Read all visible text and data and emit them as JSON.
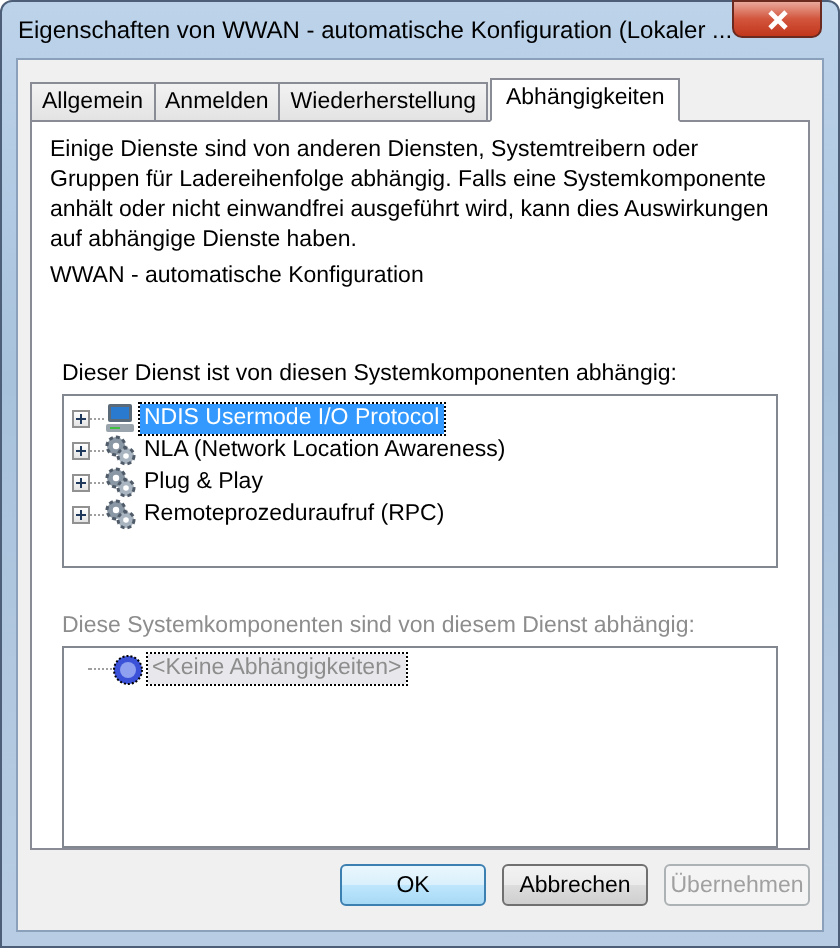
{
  "window": {
    "title": "Eigenschaften von WWAN - automatische Konfiguration (Lokaler ..."
  },
  "tabs": [
    {
      "label": "Allgemein",
      "selected": false
    },
    {
      "label": "Anmelden",
      "selected": false
    },
    {
      "label": "Wiederherstellung",
      "selected": false
    },
    {
      "label": "Abhängigkeiten",
      "selected": true
    }
  ],
  "description": "Einige Dienste sind von anderen Diensten, Systemtreibern oder Gruppen für Ladereihenfolge abhängig. Falls eine Systemkomponente anhält oder nicht einwandfrei ausgeführt wird, kann dies Auswirkungen auf abhängige Dienste haben.",
  "service_name": "WWAN - automatische Konfiguration",
  "depends_on": {
    "label": "Dieser Dienst ist von diesen Systemkomponenten abhängig:",
    "disabled": false,
    "items": [
      {
        "label": "NDIS Usermode I/O Protocol",
        "kind": "computer",
        "selected": true,
        "expanded": false
      },
      {
        "label": "NLA (Network Location Awareness)",
        "kind": "gear",
        "selected": false,
        "expanded": false
      },
      {
        "label": "Plug & Play",
        "kind": "gear",
        "selected": false,
        "expanded": false
      },
      {
        "label": "Remoteprozeduraufruf (RPC)",
        "kind": "gear",
        "selected": false,
        "expanded": false
      }
    ]
  },
  "dependents": {
    "label": "Diese Systemkomponenten sind von diesem Dienst abhängig:",
    "disabled": true,
    "items": [
      {
        "label": "<Keine Abhängigkeiten>",
        "kind": "none",
        "selected": true
      }
    ]
  },
  "buttons": [
    {
      "label": "OK",
      "default": true,
      "disabled": false
    },
    {
      "label": "Abbrechen",
      "default": false,
      "disabled": false
    },
    {
      "label": "Übernehmen",
      "default": false,
      "disabled": true
    }
  ]
}
